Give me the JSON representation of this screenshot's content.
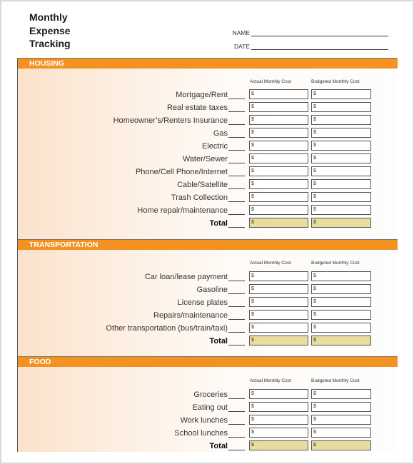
{
  "document": {
    "title_lines": [
      "Monthly",
      "Expense",
      "Tracking"
    ],
    "name_label": "NAME",
    "date_label": "DATE"
  },
  "columns": {
    "actual": "Actual Monthly Cost",
    "budgeted": "Budgeted Monthly Cost"
  },
  "currency_symbol": "$",
  "colors": {
    "section_bar": "#f39221",
    "total_field": "#e8dd9f"
  },
  "sections": [
    {
      "title": "HOUSING",
      "items": [
        "Mortgage/Rent",
        "Real estate taxes",
        "Homeowner’s/Renters Insurance",
        "Gas",
        "Electric",
        "Water/Sewer",
        "Phone/Cell Phone/Internet",
        "Cable/Satellite",
        "Trash Collection",
        "Home repair/maintenance"
      ],
      "total_label": "Total"
    },
    {
      "title": "TRANSPORTATION",
      "items": [
        "Car loan/lease payment",
        "Gasoline",
        "License plates",
        "Repairs/maintenance",
        "Other transportation (bus/train/taxi)"
      ],
      "total_label": "Total"
    },
    {
      "title": "FOOD",
      "items": [
        "Groceries",
        "Eating out",
        "Work lunches",
        "School lunches"
      ],
      "total_label": "Total"
    }
  ]
}
